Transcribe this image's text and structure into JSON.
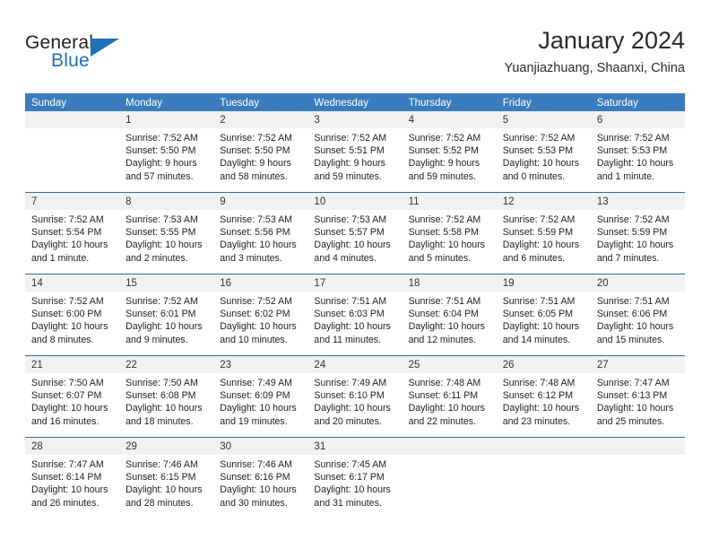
{
  "brand": {
    "word_general": "General",
    "word_blue": "Blue",
    "triangle_color": "#1f71b8"
  },
  "header": {
    "title": "January 2024",
    "subtitle": "Yuanjiazhuang, Shaanxi, China"
  },
  "theme": {
    "header_bar": "#3a7cbe",
    "week_divider": "#2e6da4",
    "day_band": "#f1f1f1",
    "text": "#222222"
  },
  "weekdays": [
    "Sunday",
    "Monday",
    "Tuesday",
    "Wednesday",
    "Thursday",
    "Friday",
    "Saturday"
  ],
  "weeks": [
    [
      {
        "day": ""
      },
      {
        "day": "1",
        "sunrise": "Sunrise: 7:52 AM",
        "sunset": "Sunset: 5:50 PM",
        "daylight1": "Daylight: 9 hours",
        "daylight2": "and 57 minutes."
      },
      {
        "day": "2",
        "sunrise": "Sunrise: 7:52 AM",
        "sunset": "Sunset: 5:50 PM",
        "daylight1": "Daylight: 9 hours",
        "daylight2": "and 58 minutes."
      },
      {
        "day": "3",
        "sunrise": "Sunrise: 7:52 AM",
        "sunset": "Sunset: 5:51 PM",
        "daylight1": "Daylight: 9 hours",
        "daylight2": "and 59 minutes."
      },
      {
        "day": "4",
        "sunrise": "Sunrise: 7:52 AM",
        "sunset": "Sunset: 5:52 PM",
        "daylight1": "Daylight: 9 hours",
        "daylight2": "and 59 minutes."
      },
      {
        "day": "5",
        "sunrise": "Sunrise: 7:52 AM",
        "sunset": "Sunset: 5:53 PM",
        "daylight1": "Daylight: 10 hours",
        "daylight2": "and 0 minutes."
      },
      {
        "day": "6",
        "sunrise": "Sunrise: 7:52 AM",
        "sunset": "Sunset: 5:53 PM",
        "daylight1": "Daylight: 10 hours",
        "daylight2": "and 1 minute."
      }
    ],
    [
      {
        "day": "7",
        "sunrise": "Sunrise: 7:52 AM",
        "sunset": "Sunset: 5:54 PM",
        "daylight1": "Daylight: 10 hours",
        "daylight2": "and 1 minute."
      },
      {
        "day": "8",
        "sunrise": "Sunrise: 7:53 AM",
        "sunset": "Sunset: 5:55 PM",
        "daylight1": "Daylight: 10 hours",
        "daylight2": "and 2 minutes."
      },
      {
        "day": "9",
        "sunrise": "Sunrise: 7:53 AM",
        "sunset": "Sunset: 5:56 PM",
        "daylight1": "Daylight: 10 hours",
        "daylight2": "and 3 minutes."
      },
      {
        "day": "10",
        "sunrise": "Sunrise: 7:53 AM",
        "sunset": "Sunset: 5:57 PM",
        "daylight1": "Daylight: 10 hours",
        "daylight2": "and 4 minutes."
      },
      {
        "day": "11",
        "sunrise": "Sunrise: 7:52 AM",
        "sunset": "Sunset: 5:58 PM",
        "daylight1": "Daylight: 10 hours",
        "daylight2": "and 5 minutes."
      },
      {
        "day": "12",
        "sunrise": "Sunrise: 7:52 AM",
        "sunset": "Sunset: 5:59 PM",
        "daylight1": "Daylight: 10 hours",
        "daylight2": "and 6 minutes."
      },
      {
        "day": "13",
        "sunrise": "Sunrise: 7:52 AM",
        "sunset": "Sunset: 5:59 PM",
        "daylight1": "Daylight: 10 hours",
        "daylight2": "and 7 minutes."
      }
    ],
    [
      {
        "day": "14",
        "sunrise": "Sunrise: 7:52 AM",
        "sunset": "Sunset: 6:00 PM",
        "daylight1": "Daylight: 10 hours",
        "daylight2": "and 8 minutes."
      },
      {
        "day": "15",
        "sunrise": "Sunrise: 7:52 AM",
        "sunset": "Sunset: 6:01 PM",
        "daylight1": "Daylight: 10 hours",
        "daylight2": "and 9 minutes."
      },
      {
        "day": "16",
        "sunrise": "Sunrise: 7:52 AM",
        "sunset": "Sunset: 6:02 PM",
        "daylight1": "Daylight: 10 hours",
        "daylight2": "and 10 minutes."
      },
      {
        "day": "17",
        "sunrise": "Sunrise: 7:51 AM",
        "sunset": "Sunset: 6:03 PM",
        "daylight1": "Daylight: 10 hours",
        "daylight2": "and 11 minutes."
      },
      {
        "day": "18",
        "sunrise": "Sunrise: 7:51 AM",
        "sunset": "Sunset: 6:04 PM",
        "daylight1": "Daylight: 10 hours",
        "daylight2": "and 12 minutes."
      },
      {
        "day": "19",
        "sunrise": "Sunrise: 7:51 AM",
        "sunset": "Sunset: 6:05 PM",
        "daylight1": "Daylight: 10 hours",
        "daylight2": "and 14 minutes."
      },
      {
        "day": "20",
        "sunrise": "Sunrise: 7:51 AM",
        "sunset": "Sunset: 6:06 PM",
        "daylight1": "Daylight: 10 hours",
        "daylight2": "and 15 minutes."
      }
    ],
    [
      {
        "day": "21",
        "sunrise": "Sunrise: 7:50 AM",
        "sunset": "Sunset: 6:07 PM",
        "daylight1": "Daylight: 10 hours",
        "daylight2": "and 16 minutes."
      },
      {
        "day": "22",
        "sunrise": "Sunrise: 7:50 AM",
        "sunset": "Sunset: 6:08 PM",
        "daylight1": "Daylight: 10 hours",
        "daylight2": "and 18 minutes."
      },
      {
        "day": "23",
        "sunrise": "Sunrise: 7:49 AM",
        "sunset": "Sunset: 6:09 PM",
        "daylight1": "Daylight: 10 hours",
        "daylight2": "and 19 minutes."
      },
      {
        "day": "24",
        "sunrise": "Sunrise: 7:49 AM",
        "sunset": "Sunset: 6:10 PM",
        "daylight1": "Daylight: 10 hours",
        "daylight2": "and 20 minutes."
      },
      {
        "day": "25",
        "sunrise": "Sunrise: 7:48 AM",
        "sunset": "Sunset: 6:11 PM",
        "daylight1": "Daylight: 10 hours",
        "daylight2": "and 22 minutes."
      },
      {
        "day": "26",
        "sunrise": "Sunrise: 7:48 AM",
        "sunset": "Sunset: 6:12 PM",
        "daylight1": "Daylight: 10 hours",
        "daylight2": "and 23 minutes."
      },
      {
        "day": "27",
        "sunrise": "Sunrise: 7:47 AM",
        "sunset": "Sunset: 6:13 PM",
        "daylight1": "Daylight: 10 hours",
        "daylight2": "and 25 minutes."
      }
    ],
    [
      {
        "day": "28",
        "sunrise": "Sunrise: 7:47 AM",
        "sunset": "Sunset: 6:14 PM",
        "daylight1": "Daylight: 10 hours",
        "daylight2": "and 26 minutes."
      },
      {
        "day": "29",
        "sunrise": "Sunrise: 7:46 AM",
        "sunset": "Sunset: 6:15 PM",
        "daylight1": "Daylight: 10 hours",
        "daylight2": "and 28 minutes."
      },
      {
        "day": "30",
        "sunrise": "Sunrise: 7:46 AM",
        "sunset": "Sunset: 6:16 PM",
        "daylight1": "Daylight: 10 hours",
        "daylight2": "and 30 minutes."
      },
      {
        "day": "31",
        "sunrise": "Sunrise: 7:45 AM",
        "sunset": "Sunset: 6:17 PM",
        "daylight1": "Daylight: 10 hours",
        "daylight2": "and 31 minutes."
      },
      {
        "day": ""
      },
      {
        "day": ""
      },
      {
        "day": ""
      }
    ]
  ]
}
